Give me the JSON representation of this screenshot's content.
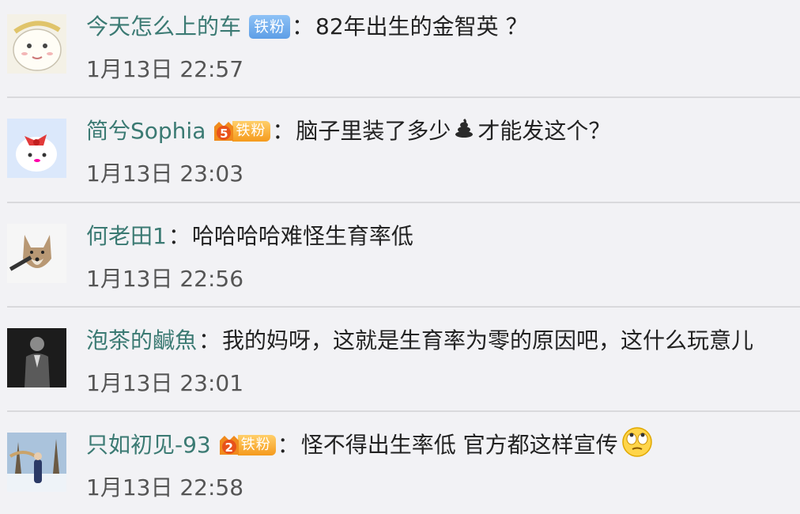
{
  "comments": [
    {
      "avatar": "cartoon-face-avatar",
      "username": "今天怎么上的车",
      "badge": {
        "type": "blue",
        "label": "铁粉"
      },
      "colon": "：",
      "text": "82年出生的金智英 ？",
      "time": "1月13日 22:57"
    },
    {
      "avatar": "white-cartoon-bird-avatar",
      "username": "简兮Sophia",
      "badge": {
        "type": "gold",
        "level": "5",
        "label": "铁粉"
      },
      "colon": "：",
      "text_before": "脑子里装了多少",
      "emoji": "poop-emoji",
      "text_after": " 才能发这个？",
      "time": "1月13日 23:03"
    },
    {
      "avatar": "fox-with-gun-avatar",
      "username": "何老田1",
      "colon": "：",
      "text": "哈哈哈哈难怪生育率低",
      "time": "1月13日 22:56"
    },
    {
      "avatar": "person-in-suit-avatar",
      "username": "泡茶的鹹魚",
      "colon": "：",
      "text": "我的妈呀，这就是生育率为零的原因吧，这什么玩意儿",
      "time": "1月13日 23:01"
    },
    {
      "avatar": "snowy-trees-photo-avatar",
      "username": "只如初见-93",
      "badge": {
        "type": "gold",
        "level": "2",
        "label": "铁粉"
      },
      "colon": "：",
      "text": "怪不得出生率低 官方都这样宣传",
      "emoji": "eye-roll-emoji",
      "time": "1月13日 22:58"
    }
  ]
}
